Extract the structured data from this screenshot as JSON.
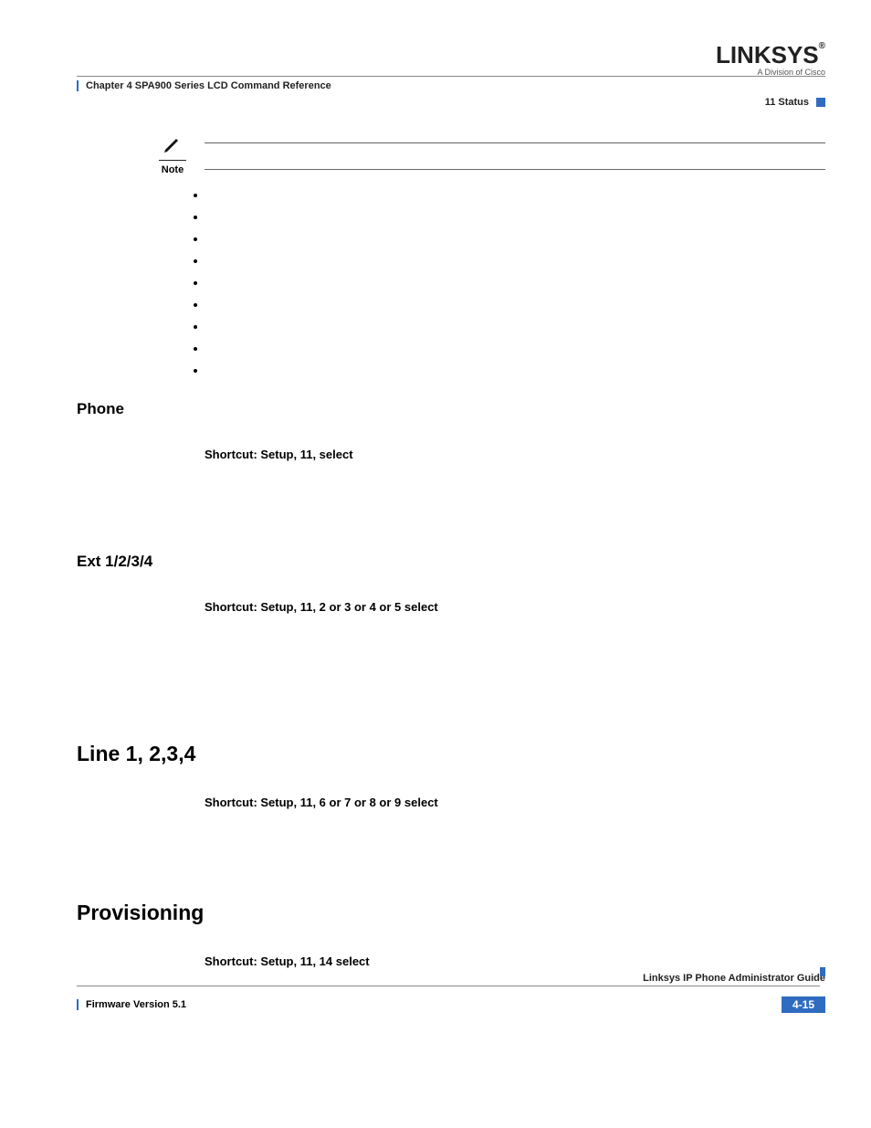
{
  "brand": {
    "name": "LINKSYS",
    "reg": "®",
    "sub": "A Division of Cisco"
  },
  "header": {
    "chapter": "Chapter 4    SPA900 Series LCD Command Reference",
    "status": "11 Status"
  },
  "note": {
    "label": "Note"
  },
  "sections": {
    "phone": {
      "title": "Phone",
      "shortcut": "Shortcut: Setup, 11, select"
    },
    "ext": {
      "title": "Ext 1/2/3/4",
      "shortcut": "Shortcut: Setup, 11, 2 or 3 or 4 or 5 select"
    },
    "line": {
      "title": "Line 1, 2,3,4",
      "shortcut": "Shortcut: Setup, 11, 6 or 7 or 8 or 9 select"
    },
    "prov": {
      "title": "Provisioning",
      "shortcut": "Shortcut: Setup, 11, 14 select"
    }
  },
  "footer": {
    "guide": "Linksys IP Phone Administrator Guide",
    "fw": "Firmware Version 5.1",
    "page": "4-15"
  }
}
